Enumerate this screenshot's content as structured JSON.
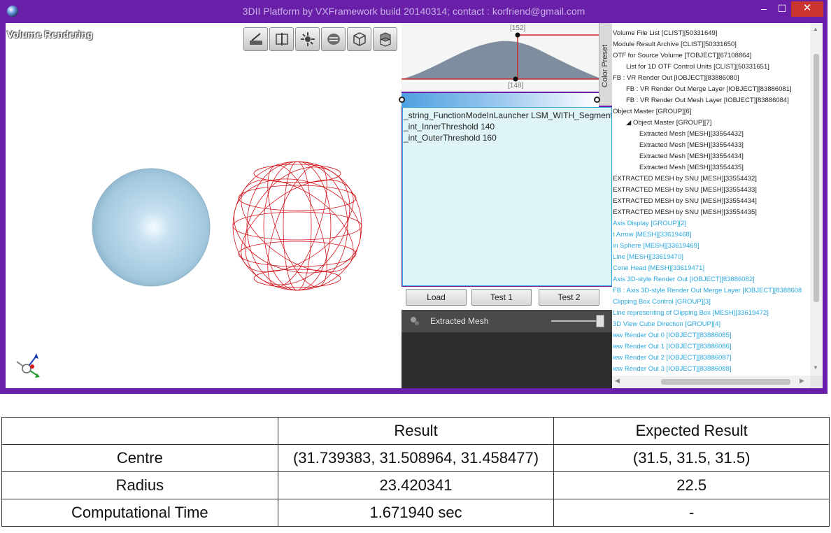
{
  "window": {
    "title": "3DII Platform by VXFramework build 20140314; contact : korfriend@gmail.com",
    "accent_color": "#6a1fa8",
    "controls": {
      "minimize": "–",
      "maximize": "☐",
      "close": "✕"
    }
  },
  "viewport": {
    "title": "Volume Rendering",
    "toolbar_icons": [
      "brush-icon",
      "slice-icon",
      "gear-burst-icon",
      "layers-icon",
      "cube-icon",
      "cube-stack-icon"
    ],
    "objects": [
      "solid-sphere",
      "wireframe-sphere"
    ],
    "sphere_color": "#a9cde2",
    "wire_color": "#d4141c"
  },
  "transfer_function": {
    "upper_label": "[152]",
    "lower_label": "[148]",
    "side_tab": "Color Preset"
  },
  "script": {
    "lines": [
      "_string_FunctionModeInLauncher LSM_WITH_Segment",
      "_int_InnerThreshold 140",
      "_int_OuterThreshold 160"
    ]
  },
  "buttons": {
    "load": "Load",
    "test1": "Test 1",
    "test2": "Test 2"
  },
  "mesh_panel": {
    "label": "Extracted Mesh"
  },
  "tree": {
    "items": [
      {
        "label": "Volume File List [CLIST][50331649]",
        "indent": 0,
        "blue": false
      },
      {
        "label": "Module Result Archive [CLIST][50331650]",
        "indent": 0,
        "blue": false
      },
      {
        "label": "OTF for Source Volume [TOBJECT][67108864]",
        "indent": 0,
        "blue": false
      },
      {
        "label": "List for 1D OTF Control Units [CLIST][50331651]",
        "indent": 1,
        "blue": false
      },
      {
        "label": "FB : VR Render Out [IOBJECT][83886080]",
        "indent": 0,
        "blue": false
      },
      {
        "label": "FB : VR Render Out Merge Layer [IOBJECT][83886081]",
        "indent": 1,
        "blue": false
      },
      {
        "label": "FB : VR Render Out Mesh Layer [IOBJECT][83886084]",
        "indent": 1,
        "blue": false
      },
      {
        "label": "Object Master [GROUP][6]",
        "indent": 0,
        "blue": false
      },
      {
        "label": "◢  Object Master [GROUP][7]",
        "indent": 1,
        "blue": false
      },
      {
        "label": "Extracted Mesh [MESH][33554432]",
        "indent": 2,
        "blue": false
      },
      {
        "label": "Extracted Mesh [MESH][33554433]",
        "indent": 2,
        "blue": false
      },
      {
        "label": "Extracted Mesh [MESH][33554434]",
        "indent": 2,
        "blue": false
      },
      {
        "label": "Extracted Mesh [MESH][33554435]",
        "indent": 2,
        "blue": false
      },
      {
        "label": "EXTRACTED MESH by SNU [MESH][33554432]",
        "indent": 0,
        "blue": false
      },
      {
        "label": "EXTRACTED MESH by SNU [MESH][33554433]",
        "indent": 0,
        "blue": false
      },
      {
        "label": "EXTRACTED MESH by SNU [MESH][33554434]",
        "indent": 0,
        "blue": false
      },
      {
        "label": "EXTRACTED MESH by SNU [MESH][33554435]",
        "indent": 0,
        "blue": false
      },
      {
        "label": "Axis Display [GROUP][2]",
        "indent": 0,
        "blue": true
      },
      {
        "label": "t Arrow [MESH][33619468]",
        "indent": 0,
        "blue": true
      },
      {
        "label": "in Sphere [MESH][33619469]",
        "indent": 0,
        "blue": true
      },
      {
        "label": "Line [MESH][33619470]",
        "indent": 0,
        "blue": true
      },
      {
        "label": "Cone Head [MESH][33619471]",
        "indent": 0,
        "blue": true
      },
      {
        "label": "Axis 3D-style Render Out [IOBJECT][83886082]",
        "indent": 0,
        "blue": true
      },
      {
        "label": "FB : Axis 3D-style Render Out Merge Layer [IOBJECT][8388608",
        "indent": 0,
        "blue": true
      },
      {
        "label": "Clipping Box Control [GROUP][3]",
        "indent": 0,
        "blue": true
      },
      {
        "label": "Line representing of Clipping Box [MESH][33619472]",
        "indent": 0,
        "blue": true
      },
      {
        "label": "3D View Cube Direction [GROUP][4]",
        "indent": 0,
        "blue": true
      },
      {
        "label": "iew Render Out 0 [IOBJECT][83886085]",
        "indent": 0,
        "blue": true
      },
      {
        "label": "iew Render Out 1 [IOBJECT][83886086]",
        "indent": 0,
        "blue": true
      },
      {
        "label": "iew Render Out 2 [IOBJECT][83886087]",
        "indent": 0,
        "blue": true
      },
      {
        "label": "iew Render Out 3 [IOBJECT][83886088]",
        "indent": 0,
        "blue": true
      }
    ]
  },
  "results_table": {
    "headers": [
      "",
      "Result",
      "Expected Result"
    ],
    "rows": [
      [
        "Centre",
        "(31.739383, 31.508964, 31.458477)",
        "(31.5, 31.5, 31.5)"
      ],
      [
        "Radius",
        "23.420341",
        "22.5"
      ],
      [
        "Computational Time",
        "1.671940 sec",
        "-"
      ]
    ]
  }
}
